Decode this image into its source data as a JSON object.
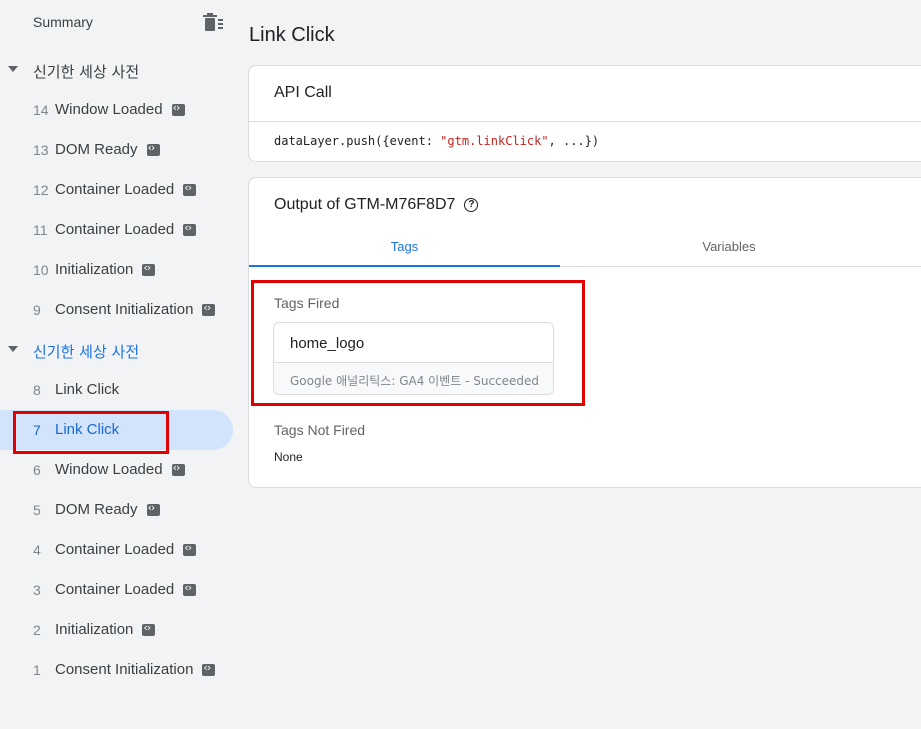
{
  "sidebar": {
    "summary_label": "Summary",
    "groups": [
      {
        "label": "신기한 세상 사전"
      },
      {
        "label": "신기한 세상 사전"
      }
    ],
    "events": [
      {
        "num": "14",
        "label": "Window Loaded"
      },
      {
        "num": "13",
        "label": "DOM Ready"
      },
      {
        "num": "12",
        "label": "Container Loaded"
      },
      {
        "num": "11",
        "label": "Container Loaded"
      },
      {
        "num": "10",
        "label": "Initialization"
      },
      {
        "num": "9",
        "label": "Consent Initialization"
      },
      {
        "num": "8",
        "label": "Link Click"
      },
      {
        "num": "7",
        "label": "Link Click"
      },
      {
        "num": "6",
        "label": "Window Loaded"
      },
      {
        "num": "5",
        "label": "DOM Ready"
      },
      {
        "num": "4",
        "label": "Container Loaded"
      },
      {
        "num": "3",
        "label": "Container Loaded"
      },
      {
        "num": "2",
        "label": "Initialization"
      },
      {
        "num": "1",
        "label": "Consent Initialization"
      }
    ]
  },
  "main": {
    "title": "Link Click",
    "api_call": {
      "title": "API Call",
      "code_prefix": "dataLayer.push({event: ",
      "code_string": "\"gtm.linkClick\"",
      "code_suffix": ", ...})"
    },
    "output": {
      "title": "Output of GTM-M76F8D7",
      "help_icon": "?",
      "tabs": [
        {
          "label": "Tags"
        },
        {
          "label": "Variables"
        }
      ],
      "tags_fired_label": "Tags Fired",
      "fired_tag": {
        "name": "home_logo",
        "status": "Google 애널리틱스: GA4 이벤트 - Succeeded"
      },
      "tags_not_fired_label": "Tags Not Fired",
      "tags_not_fired_value": "None"
    }
  },
  "colors": {
    "accent": "#1a73e8",
    "selected_bg": "#d2e3fc",
    "highlight_box": "#e30000",
    "background": "#f1f3f4"
  }
}
